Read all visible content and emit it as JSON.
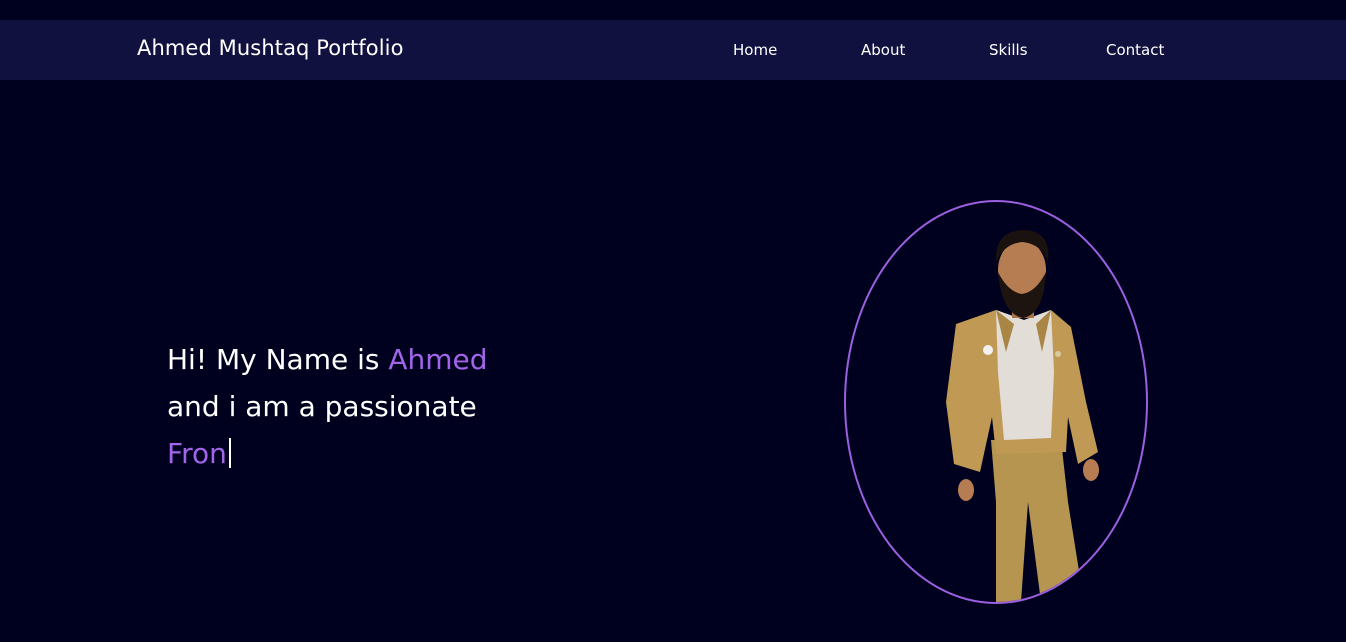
{
  "header": {
    "brand": "Ahmed Mushtaq Portfolio",
    "nav": [
      "Home",
      "About",
      "Skills",
      "Contact"
    ]
  },
  "hero": {
    "line1_prefix": "Hi! My Name is ",
    "line1_name": "Ahmed",
    "line2": "and i am a passionate",
    "typed_text": "Fron"
  },
  "portrait": {
    "icon": "person-photo",
    "ring_color": "#9b5fe0"
  },
  "colors": {
    "background": "#00001f",
    "navbar": "#111140",
    "accent": "#a264e8"
  }
}
